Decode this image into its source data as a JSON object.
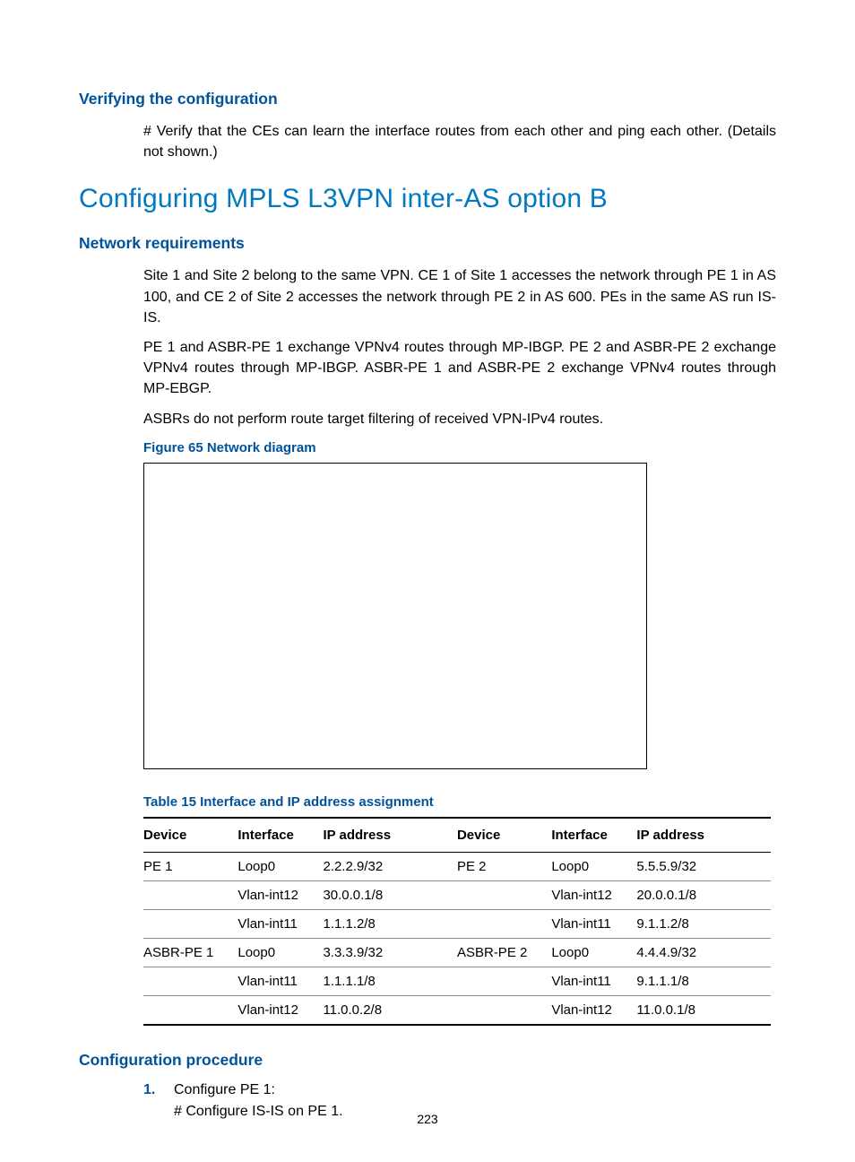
{
  "page_number": "223",
  "section_verify": {
    "heading": "Verifying the configuration",
    "body": "# Verify that the CEs can learn the interface routes from each other and ping each other. (Details not shown.)"
  },
  "section_main": {
    "heading": "Configuring MPLS L3VPN inter-AS option B"
  },
  "section_req": {
    "heading": "Network requirements",
    "p1": "Site 1 and Site 2 belong to the same VPN. CE 1 of Site 1 accesses the network through PE 1 in AS 100, and CE 2 of Site 2 accesses the network through PE 2 in AS 600. PEs in the same AS run IS-IS.",
    "p2": "PE 1 and ASBR-PE 1 exchange VPNv4 routes through MP-IBGP. PE 2 and ASBR-PE 2 exchange VPNv4 routes through MP-IBGP. ASBR-PE 1 and ASBR-PE 2 exchange VPNv4 routes through MP-EBGP.",
    "p3": "ASBRs do not perform route target filtering of received VPN-IPv4 routes."
  },
  "figure": {
    "caption": "Figure 65 Network diagram"
  },
  "table": {
    "caption": "Table 15 Interface and IP address assignment",
    "headers": [
      "Device",
      "Interface",
      "IP address",
      "Device",
      "Interface",
      "IP address"
    ],
    "rows": [
      {
        "d1": "PE 1",
        "if1": "Loop0",
        "ip1": "2.2.2.9/32",
        "d2": "PE 2",
        "if2": "Loop0",
        "ip2": "5.5.5.9/32"
      },
      {
        "d1": "",
        "if1": "Vlan-int12",
        "ip1": "30.0.0.1/8",
        "d2": "",
        "if2": "Vlan-int12",
        "ip2": "20.0.0.1/8"
      },
      {
        "d1": "",
        "if1": "Vlan-int11",
        "ip1": "1.1.1.2/8",
        "d2": "",
        "if2": "Vlan-int11",
        "ip2": "9.1.1.2/8"
      },
      {
        "d1": "ASBR-PE 1",
        "if1": "Loop0",
        "ip1": "3.3.3.9/32",
        "d2": "ASBR-PE 2",
        "if2": "Loop0",
        "ip2": "4.4.4.9/32"
      },
      {
        "d1": "",
        "if1": "Vlan-int11",
        "ip1": "1.1.1.1/8",
        "d2": "",
        "if2": "Vlan-int11",
        "ip2": "9.1.1.1/8"
      },
      {
        "d1": "",
        "if1": "Vlan-int12",
        "ip1": "11.0.0.2/8",
        "d2": "",
        "if2": "Vlan-int12",
        "ip2": "11.0.0.1/8"
      }
    ]
  },
  "section_proc": {
    "heading": "Configuration procedure",
    "step1_num": "1.",
    "step1_title": "Configure PE 1:",
    "step1_line": "# Configure IS-IS on PE 1."
  }
}
